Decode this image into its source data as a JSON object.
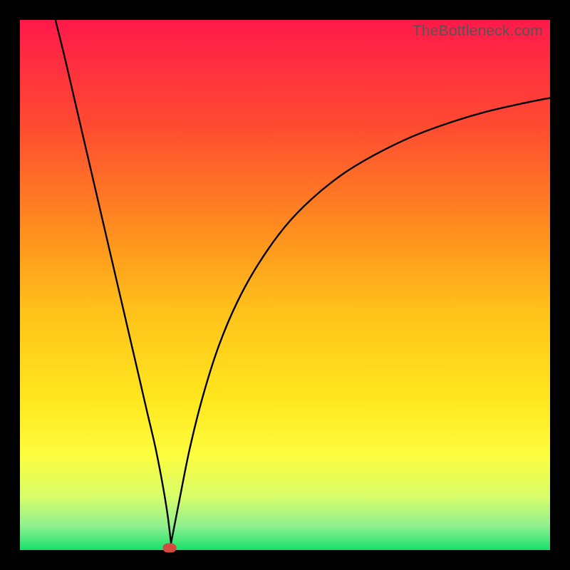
{
  "watermark": "TheBottleneck.com",
  "chart_data": {
    "type": "line",
    "title": "",
    "xlabel": "",
    "ylabel": "",
    "xlim": [
      0,
      100
    ],
    "ylim": [
      0,
      100
    ],
    "grid": false,
    "legend": false,
    "note": "V-shaped curve on a vertical red-to-green gradient background. Left branch descends nearly linearly from the top-left region down to a minimum, right branch rises with decreasing slope (concave) toward the upper right. A small red pill marker sits at the minimum near the bottom.",
    "gradient_stops": [
      {
        "pos": 0.0,
        "color": "#ff1a4a"
      },
      {
        "pos": 0.2,
        "color": "#ff4b31"
      },
      {
        "pos": 0.4,
        "color": "#ff8f1e"
      },
      {
        "pos": 0.55,
        "color": "#ffc21a"
      },
      {
        "pos": 0.72,
        "color": "#ffe81f"
      },
      {
        "pos": 0.82,
        "color": "#fdfd3e"
      },
      {
        "pos": 0.9,
        "color": "#d7fd6a"
      },
      {
        "pos": 0.955,
        "color": "#8ef08f"
      },
      {
        "pos": 1.0,
        "color": "#16e06a"
      }
    ],
    "series": [
      {
        "name": "left-branch",
        "x": [
          6.7,
          8.5,
          10.5,
          12.5,
          14.5,
          16.5,
          18.5,
          20.5,
          22.5,
          24.0,
          25.5,
          26.8,
          27.8,
          28.5
        ],
        "y": [
          100,
          92.7,
          84.1,
          75.5,
          66.9,
          58.3,
          49.7,
          41.1,
          32.5,
          26.0,
          19.6,
          13.0,
          7.0,
          1.3
        ]
      },
      {
        "name": "right-branch",
        "x": [
          28.5,
          30.0,
          32.0,
          34.5,
          37.5,
          41.0,
          45.0,
          50.0,
          55.0,
          61.0,
          67.0,
          74.0,
          81.0,
          88.0,
          95.0,
          100.0
        ],
        "y": [
          1.3,
          9.0,
          19.0,
          29.0,
          38.5,
          46.8,
          54.0,
          61.0,
          66.2,
          71.0,
          74.6,
          78.0,
          80.6,
          82.7,
          84.3,
          85.3
        ]
      }
    ],
    "marker": {
      "x": 28.2,
      "y": 0.4,
      "shape": "pill",
      "color": "#d24a3f"
    }
  }
}
